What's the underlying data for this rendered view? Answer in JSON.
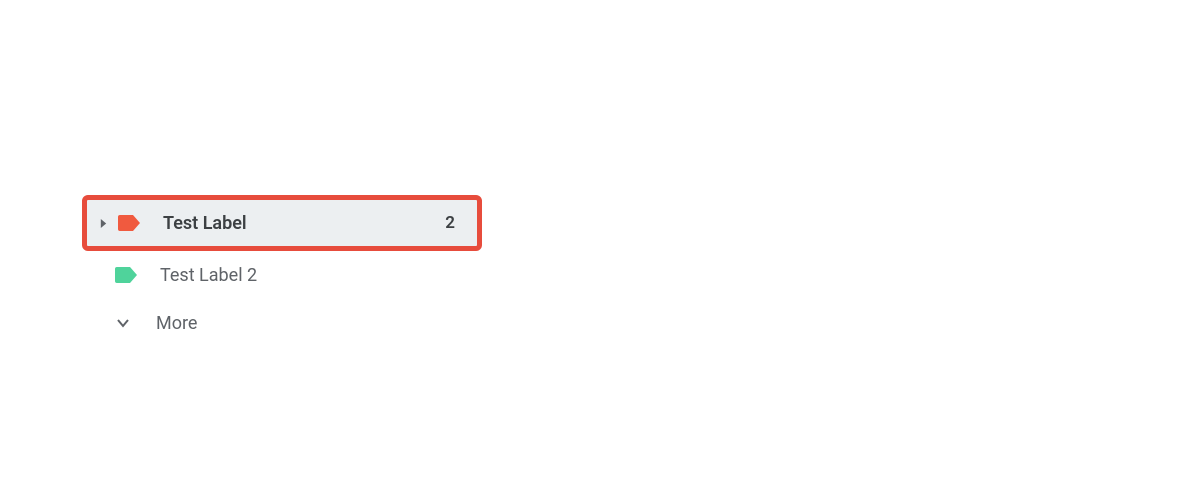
{
  "labels": [
    {
      "name": "Test Label",
      "count": "2",
      "color": "#f05a3f",
      "selected": true,
      "expandable": true
    },
    {
      "name": "Test Label 2",
      "count": "",
      "color": "#4fd39b",
      "selected": false,
      "expandable": false
    }
  ],
  "more_label": "More",
  "highlight_border_color": "#e74c3c"
}
